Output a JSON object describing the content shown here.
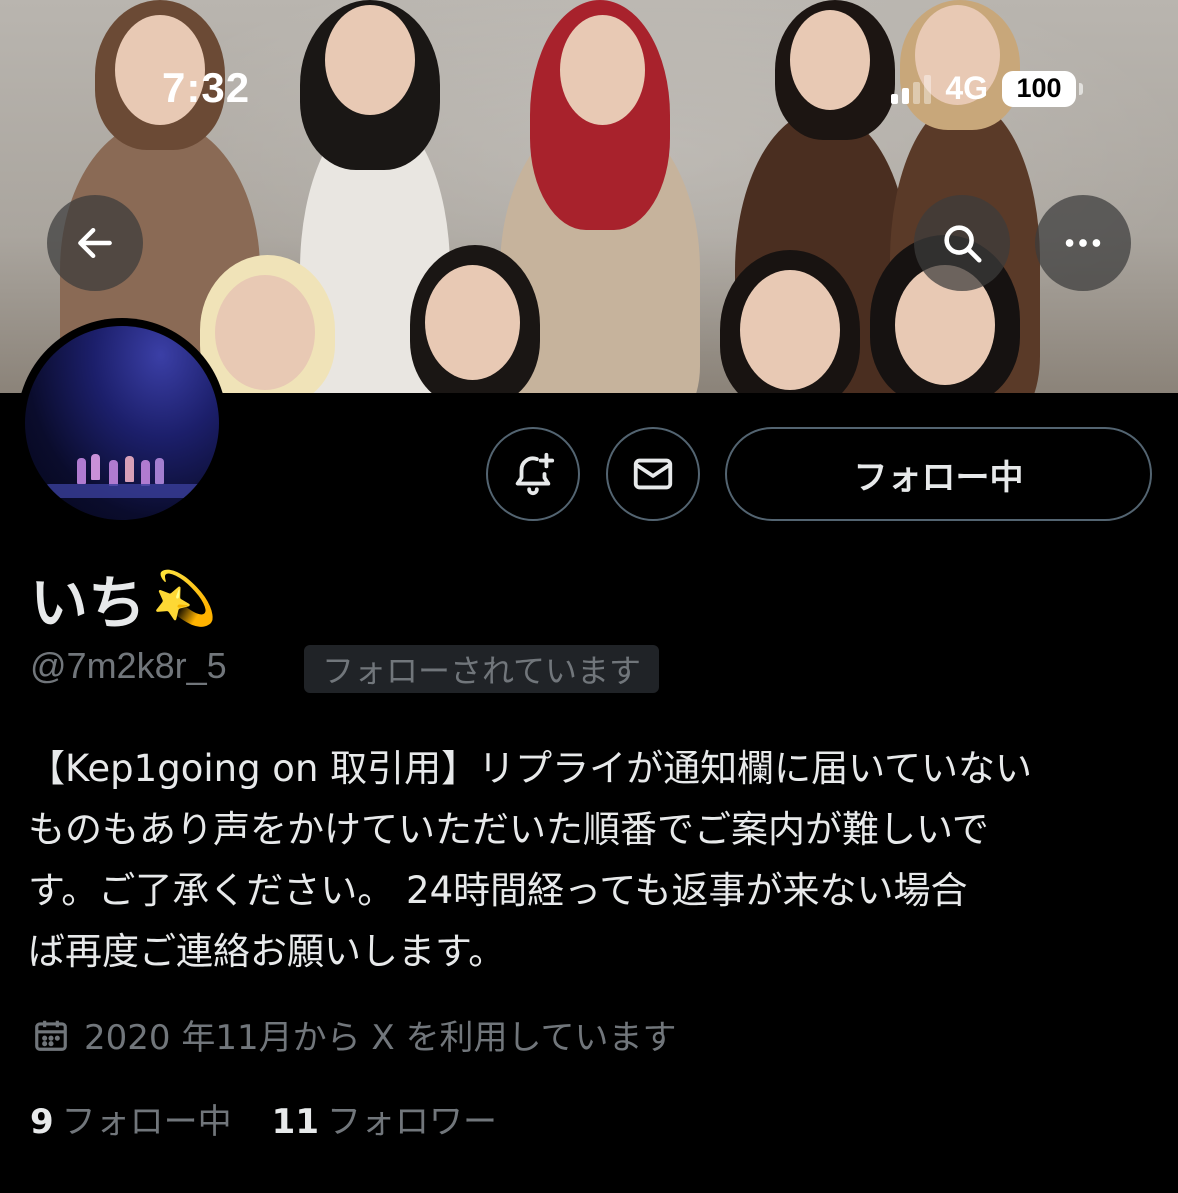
{
  "status_bar": {
    "time": "7:32",
    "network": "4G",
    "battery": "100"
  },
  "header": {
    "back_icon": "arrow-left-icon",
    "search_icon": "search-icon",
    "more_icon": "more-horizontal-icon"
  },
  "actions": {
    "notify_icon": "bell-plus-icon",
    "message_icon": "mail-icon",
    "follow_label": "フォロー中"
  },
  "profile": {
    "name": "いち",
    "name_emoji": "💫",
    "handle": "@7m2k8r_5",
    "follows_you": "フォローされています",
    "bio": "【Kep1going on 取引用】リプライが通知欄に届いていない\nものもあり声をかけていただいた順番でご案内が難しいで\nす。ご了承ください。 24時間経っても返事が来ない場合\nば再度ご連絡お願いします。",
    "joined": "2020 年11月から X を利用しています"
  },
  "stats": {
    "following_count": "9",
    "following_label": "フォロー中",
    "followers_count": "11",
    "followers_label": "フォロワー"
  },
  "colors": {
    "background": "#000000",
    "text_primary": "#e7e9ea",
    "text_secondary": "#71767b",
    "border": "#536471"
  }
}
